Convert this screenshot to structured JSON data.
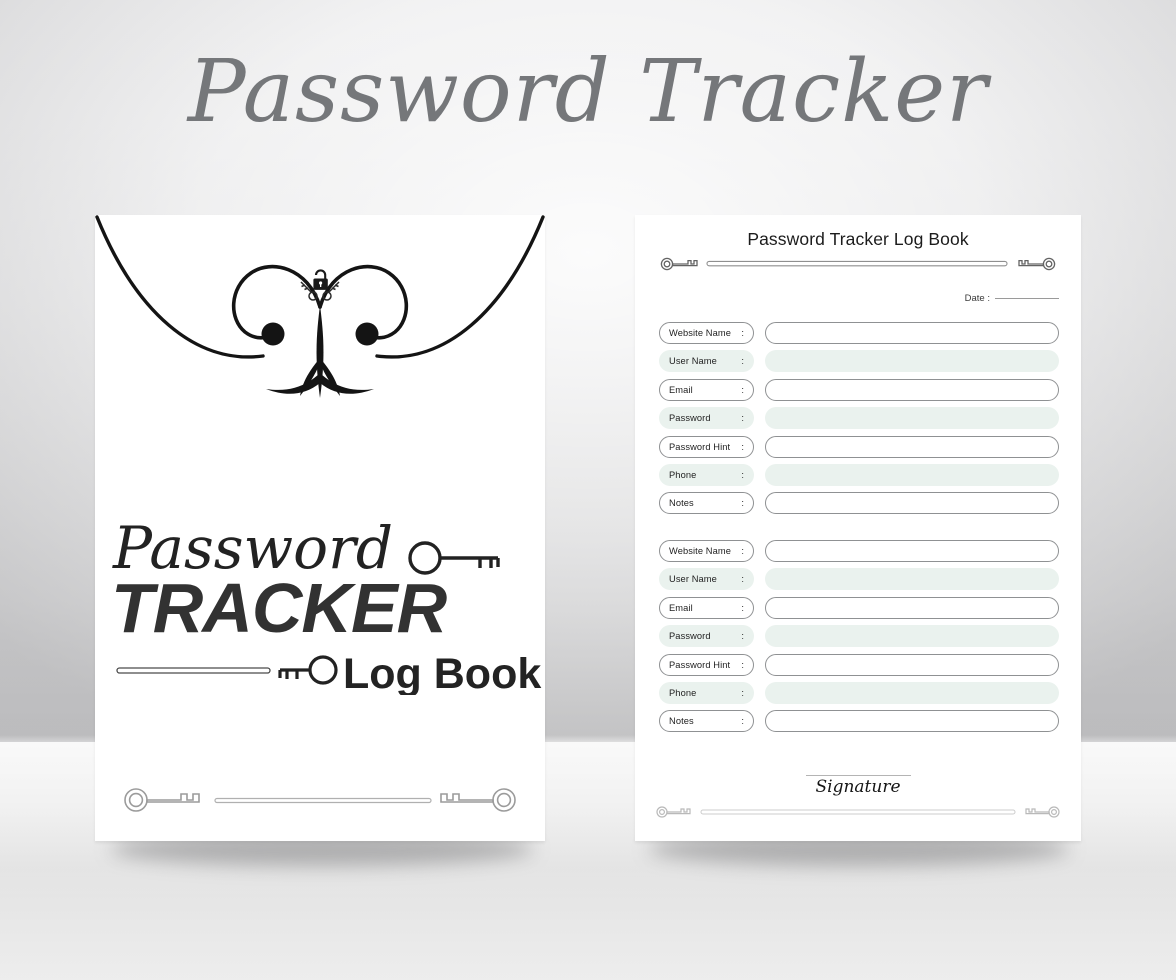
{
  "poster": {
    "title": "Password Tracker",
    "background_top_color": "#ececed",
    "background_floor_color": "#f0f0f0",
    "title_color": "#75777a"
  },
  "cover": {
    "ornament_icon": "padlock-flourish-ornament",
    "logo": {
      "script_word": "Password",
      "bold_word": "TRACKER",
      "sub_word": "Log Book",
      "key_icon_right": "key-icon",
      "key_icon_bottom": "key-icon",
      "color": "#2b2b2b"
    },
    "bottom_rule": {
      "left_icon": "key-icon",
      "right_icon": "key-icon",
      "line_color": "#9b9b9b"
    }
  },
  "log_page": {
    "header": {
      "title": "Password Tracker Log Book",
      "left_icon": "key-icon",
      "right_icon": "key-icon",
      "rule_color": "#8f8f8f"
    },
    "date": {
      "label": "Date :",
      "value": "",
      "line_color": "#9a9a9a"
    },
    "field_labels": [
      "Website Name",
      "User Name",
      "Email",
      "Password",
      "Password Hint",
      "Phone",
      "Notes"
    ],
    "colon": ":",
    "row_styles": [
      "plain",
      "tint",
      "plain",
      "tint",
      "plain",
      "tint",
      "plain"
    ],
    "tint_color": "#eaf2ee",
    "border_color": "#8f9193",
    "blocks": [
      {
        "name": "entry-block-1",
        "values": [
          "",
          "",
          "",
          "",
          "",
          "",
          ""
        ]
      },
      {
        "name": "entry-block-2",
        "values": [
          "",
          "",
          "",
          "",
          "",
          "",
          ""
        ]
      }
    ],
    "signature": {
      "label": "Signature",
      "left_icon": "key-icon",
      "right_icon": "key-icon",
      "line_color": "#c9c9c9"
    }
  }
}
